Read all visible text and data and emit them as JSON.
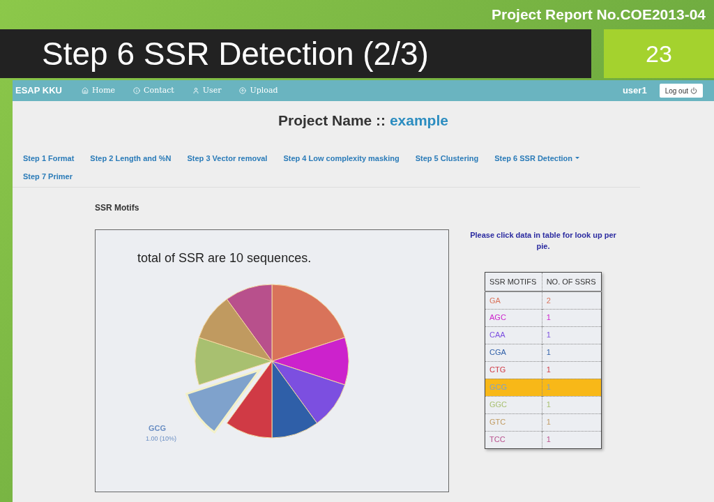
{
  "slide": {
    "header": "Project Report No.COE2013-04",
    "title": "Step 6 SSR Detection (2/3)",
    "page_number": "23"
  },
  "navbar": {
    "brand": "ESAP KKU",
    "items": [
      {
        "label": "Home"
      },
      {
        "label": "Contact"
      },
      {
        "label": "User"
      },
      {
        "label": "Upload"
      }
    ],
    "user": "user1",
    "logout": "Log out"
  },
  "project": {
    "label": "Project Name ::",
    "name": "example"
  },
  "steps": [
    {
      "label": "Step 1 Format",
      "dropdown": false
    },
    {
      "label": "Step 2 Length and %N",
      "dropdown": false
    },
    {
      "label": "Step 3 Vector removal",
      "dropdown": false
    },
    {
      "label": "Step 4 Low complexity masking",
      "dropdown": false
    },
    {
      "label": "Step 5 Clustering",
      "dropdown": false
    },
    {
      "label": "Step 6 SSR Detection",
      "dropdown": true
    },
    {
      "label": "Step 7 Primer",
      "dropdown": false
    }
  ],
  "section_title": "SSR Motifs",
  "chart": {
    "title": "total of SSR are 10 sequences.",
    "callout": {
      "label": "GCG",
      "value": "1.00 (10%)"
    }
  },
  "hint": "Please click data in table for look up per pie.",
  "table": {
    "columns": [
      "SSR MOTIFS",
      "NO. OF SSRS"
    ],
    "rows": [
      {
        "motif": "GA",
        "count": "2",
        "color": "#d9735a",
        "selected": false
      },
      {
        "motif": "AGC",
        "count": "1",
        "color": "#cc22cc",
        "selected": false
      },
      {
        "motif": "CAA",
        "count": "1",
        "color": "#7c4fe0",
        "selected": false
      },
      {
        "motif": "CGA",
        "count": "1",
        "color": "#2f5fa8",
        "selected": false
      },
      {
        "motif": "CTG",
        "count": "1",
        "color": "#d03a45",
        "selected": false
      },
      {
        "motif": "GCG",
        "count": "1",
        "color": "#7fa2cc",
        "selected": true
      },
      {
        "motif": "GGC",
        "count": "1",
        "color": "#a8c070",
        "selected": false
      },
      {
        "motif": "GTC",
        "count": "1",
        "color": "#c09a60",
        "selected": false
      },
      {
        "motif": "TCC",
        "count": "1",
        "color": "#b8508c",
        "selected": false
      }
    ]
  }
}
